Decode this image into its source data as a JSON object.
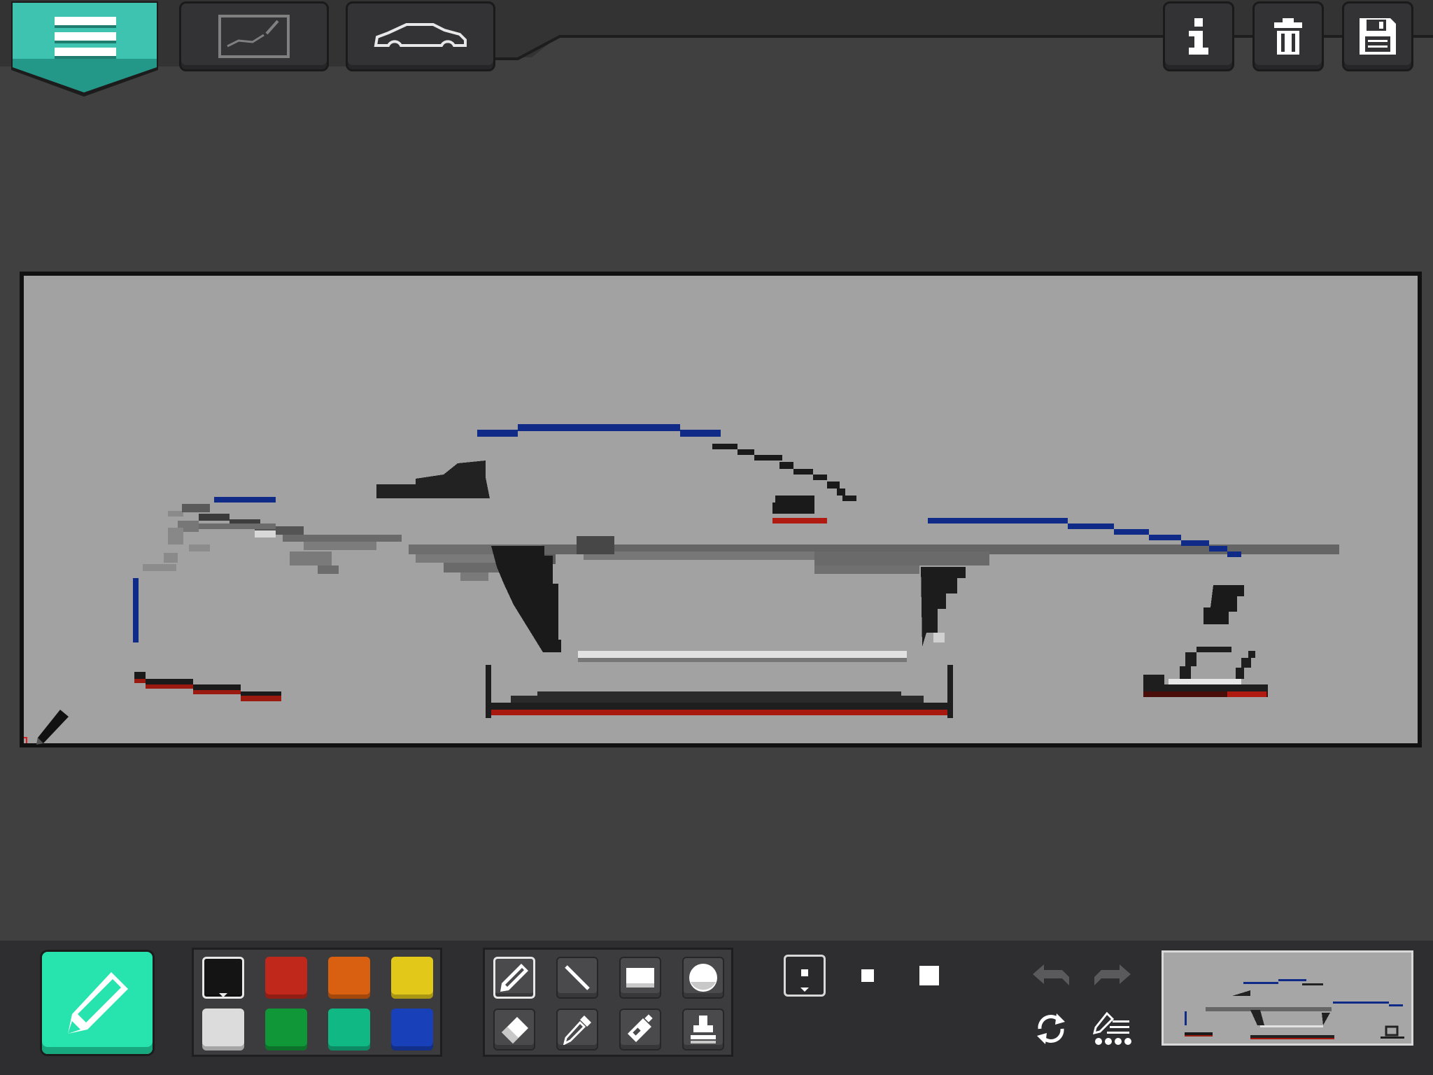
{
  "colors": {
    "accent": "#27e3ae",
    "menu_teal": "#3ec3b0",
    "canvas_bg": "#a2a2a2",
    "app_bg": "#404040"
  },
  "topbar": {
    "menu_icon": "hamburger-menu-icon",
    "buttons": [
      {
        "name": "drawing-mode",
        "icon": "sketch-frame-icon"
      },
      {
        "name": "car-template",
        "icon": "car-outline-icon"
      },
      {
        "name": "info",
        "icon": "info-icon"
      },
      {
        "name": "delete",
        "icon": "trash-icon"
      },
      {
        "name": "save",
        "icon": "floppy-disk-icon"
      }
    ]
  },
  "palette": {
    "selected": "#141414",
    "colors": [
      "#141414",
      "#c0281c",
      "#d86010",
      "#e2c818",
      "#dcdcdc",
      "#109838",
      "#10b884",
      "#1840b8"
    ]
  },
  "tools": [
    {
      "name": "pencil",
      "icon": "pencil-icon",
      "selected": true
    },
    {
      "name": "line",
      "icon": "line-icon",
      "selected": false
    },
    {
      "name": "rectangle",
      "icon": "rectangle-icon",
      "selected": false
    },
    {
      "name": "circle",
      "icon": "circle-icon",
      "selected": false
    },
    {
      "name": "eraser",
      "icon": "eraser-icon",
      "selected": false
    },
    {
      "name": "eyedropper",
      "icon": "eyedropper-icon",
      "selected": false
    },
    {
      "name": "spray",
      "icon": "spray-can-icon",
      "selected": false
    },
    {
      "name": "stamp",
      "icon": "stamp-icon",
      "selected": false
    }
  ],
  "brush_sizes": [
    "small",
    "medium",
    "large"
  ],
  "selected_brush_size": "small",
  "history": {
    "undo_icon": "undo-icon",
    "redo_icon": "redo-icon",
    "rotate_icon": "rotate-icon",
    "options_icon": "brush-options-icon"
  },
  "preview": {
    "icon": "car-preview-thumbnail"
  }
}
